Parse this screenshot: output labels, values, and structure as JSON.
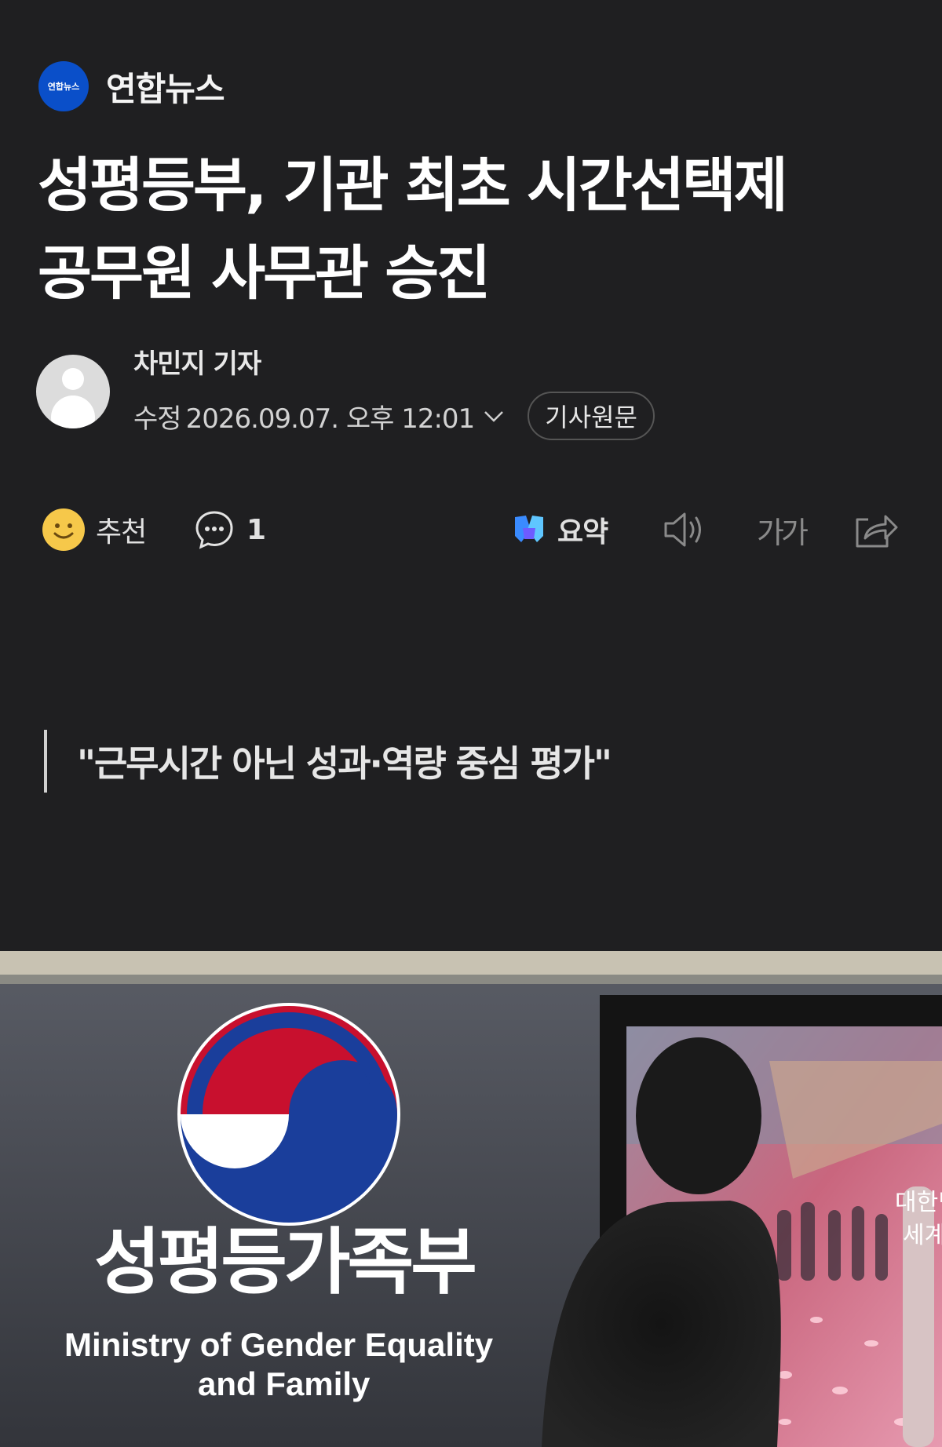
{
  "press": {
    "logo_text": "연합뉴스",
    "name": "연합뉴스",
    "brand_color": "#0a4fc9"
  },
  "article": {
    "headline_line1": "성평등부, 기관 최초 시간선택제",
    "headline_line2": "공무원 사무관 승진",
    "reporter": "차민지 기자",
    "edited_label": "수정",
    "datetime": "2026.09.07. 오후 12:01",
    "original_button": "기사원문",
    "quote": "\"근무시간 아닌 성과·역량 중심 평가\""
  },
  "toolbar": {
    "recommend_label": "추천",
    "comment_count": "1",
    "summary_label": "요약",
    "font_label": "가가"
  },
  "photo": {
    "sign_korean": "성평등가족부",
    "sign_english_line1": "Ministry of Gender Equality",
    "sign_english_line2": "and Family",
    "screen_text1": "대한민국",
    "screen_text2": "세계"
  }
}
